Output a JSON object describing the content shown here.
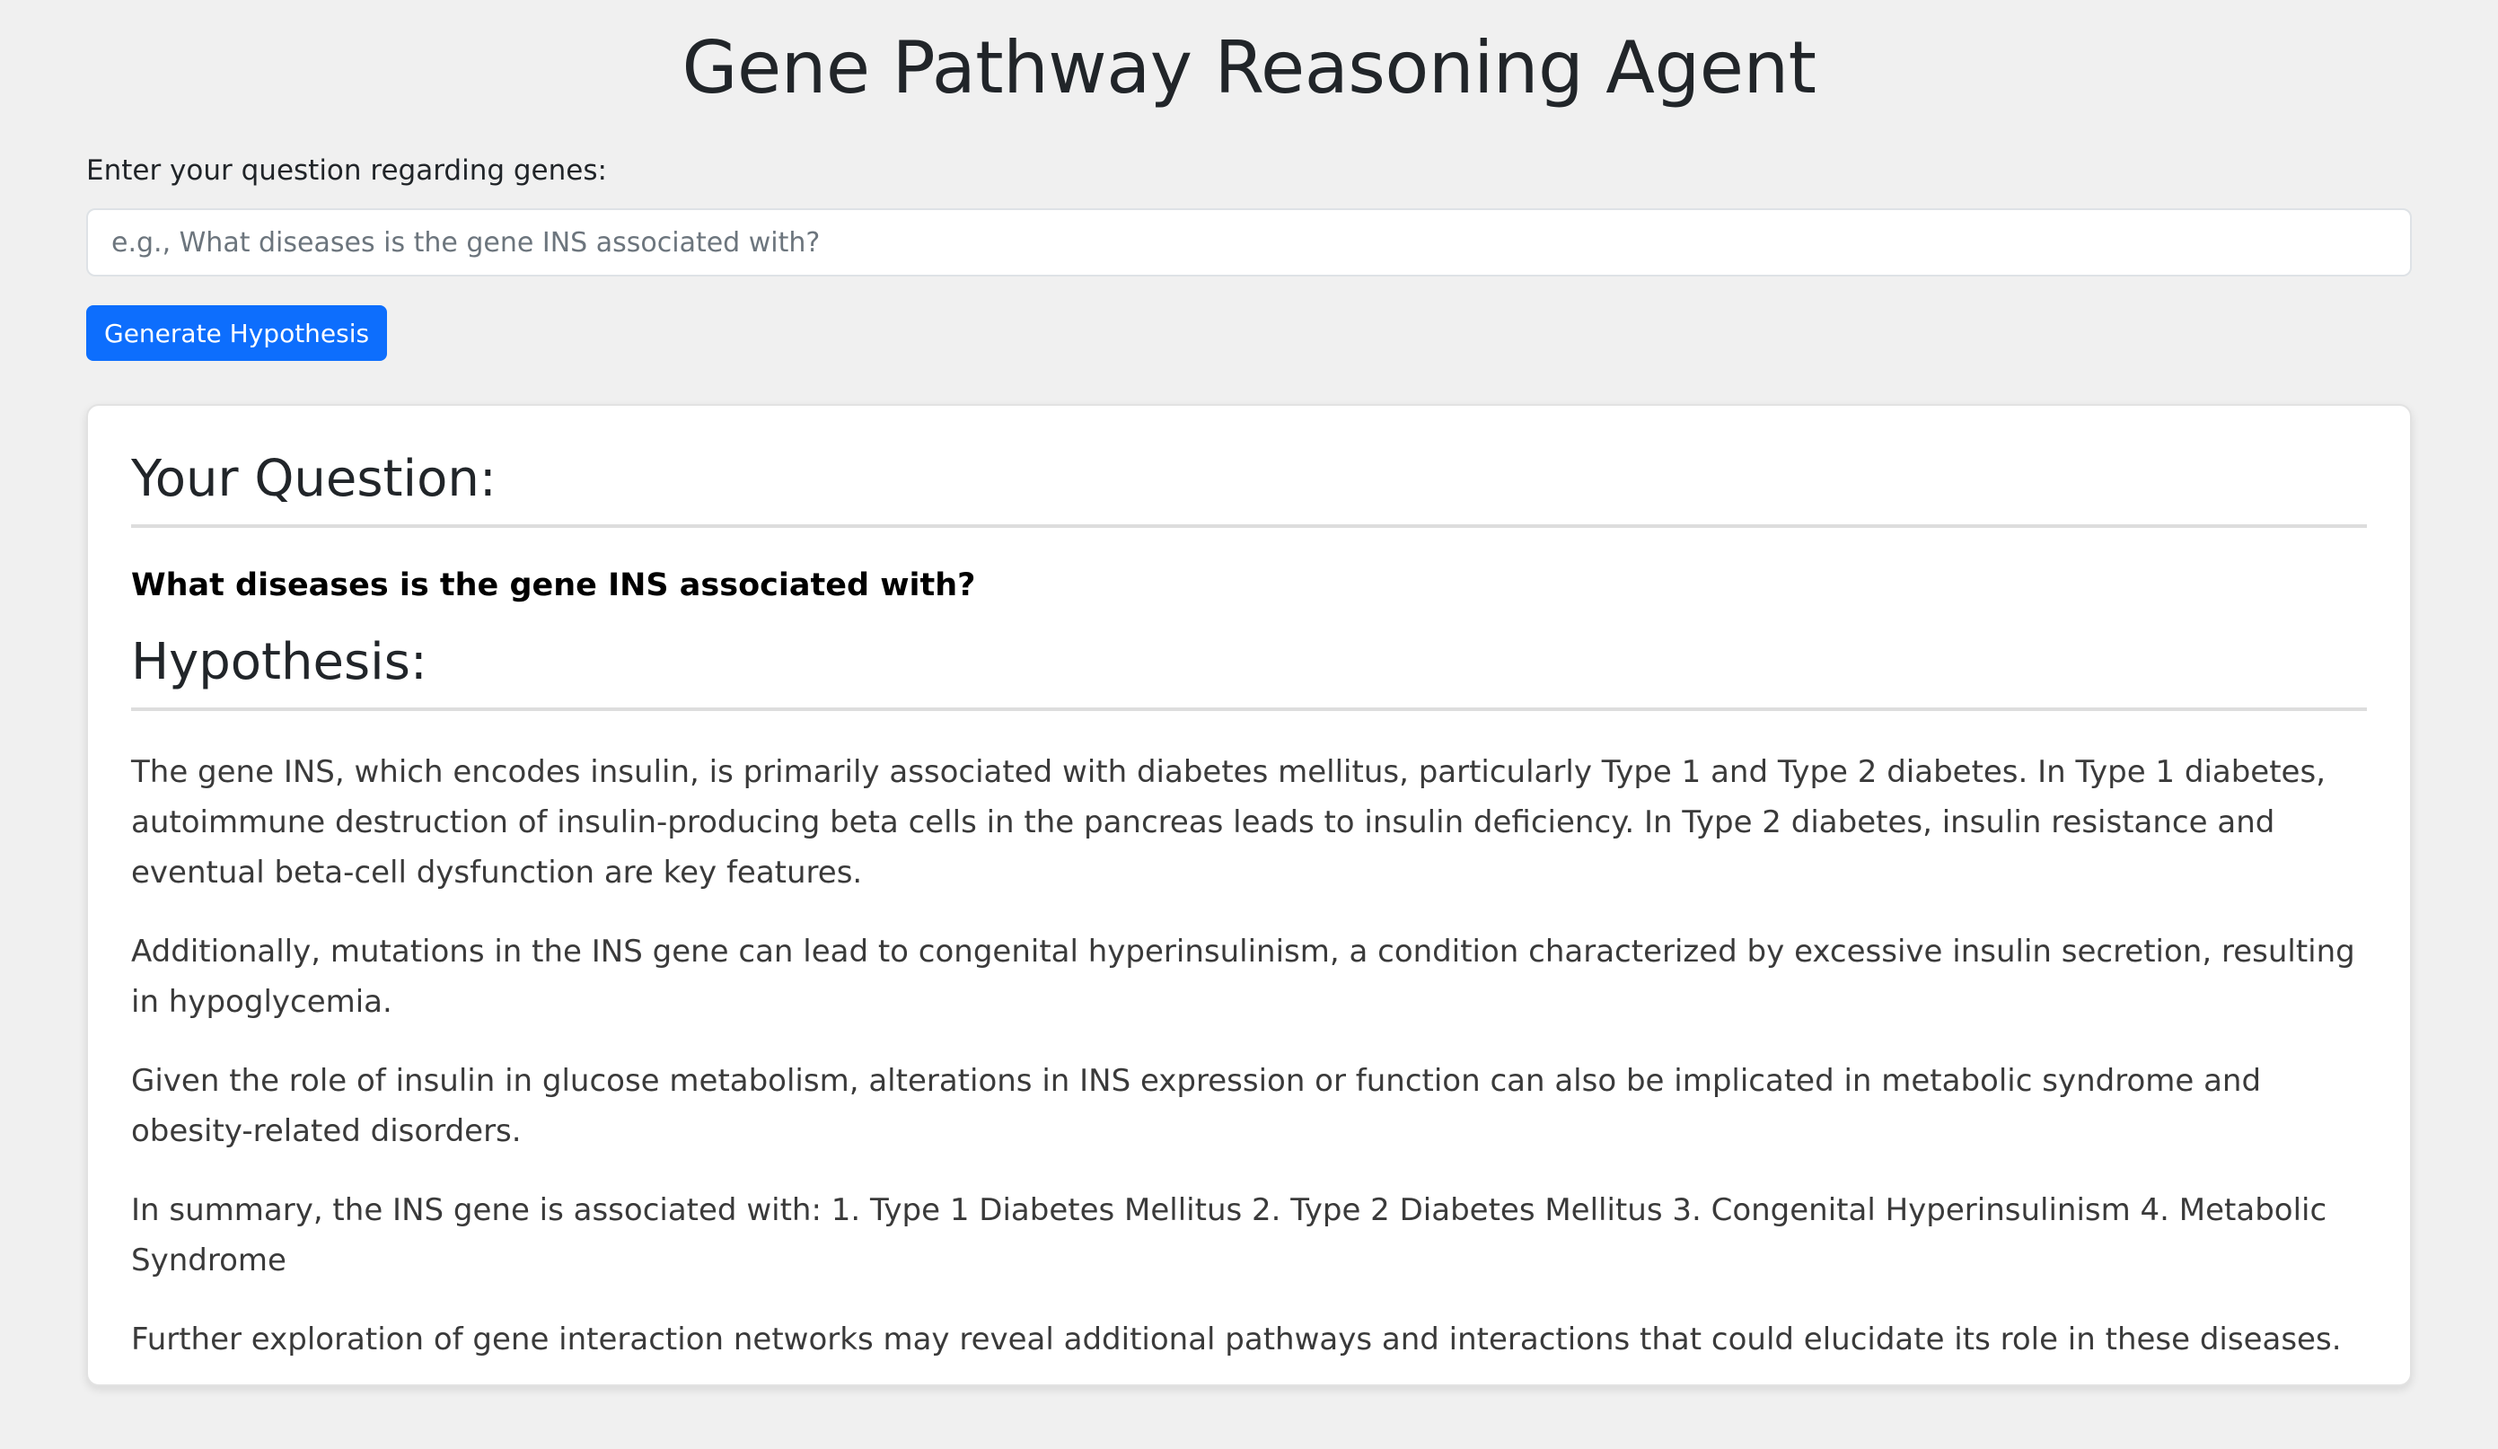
{
  "app": {
    "title": "Gene Pathway Reasoning Agent"
  },
  "form": {
    "label": "Enter your question regarding genes:",
    "input_value": "",
    "input_placeholder": "e.g., What diseases is the gene INS associated with?",
    "submit_label": "Generate Hypothesis"
  },
  "result": {
    "question_heading": "Your Question:",
    "question_text": "What diseases is the gene INS associated with?",
    "hypothesis_heading": "Hypothesis:",
    "paragraphs": [
      "The gene INS, which encodes insulin, is primarily associated with diabetes mellitus, particularly Type 1 and Type 2 diabetes. In Type 1 diabetes, autoimmune destruction of insulin-producing beta cells in the pancreas leads to insulin deficiency. In Type 2 diabetes, insulin resistance and eventual beta-cell dysfunction are key features.",
      "Additionally, mutations in the INS gene can lead to congenital hyperinsulinism, a condition characterized by excessive insulin secretion, resulting in hypoglycemia.",
      "Given the role of insulin in glucose metabolism, alterations in INS expression or function can also be implicated in metabolic syndrome and obesity-related disorders.",
      "In summary, the INS gene is associated with: 1. Type 1 Diabetes Mellitus 2. Type 2 Diabetes Mellitus 3. Congenital Hyperinsulinism 4. Metabolic Syndrome",
      "Further exploration of gene interaction networks may reveal additional pathways and interactions that could elucidate its role in these diseases."
    ]
  },
  "colors": {
    "background": "#f0f0f0",
    "primary_button": "#0d6efd",
    "card_background": "#ffffff",
    "body_text": "#3a3a3a"
  }
}
